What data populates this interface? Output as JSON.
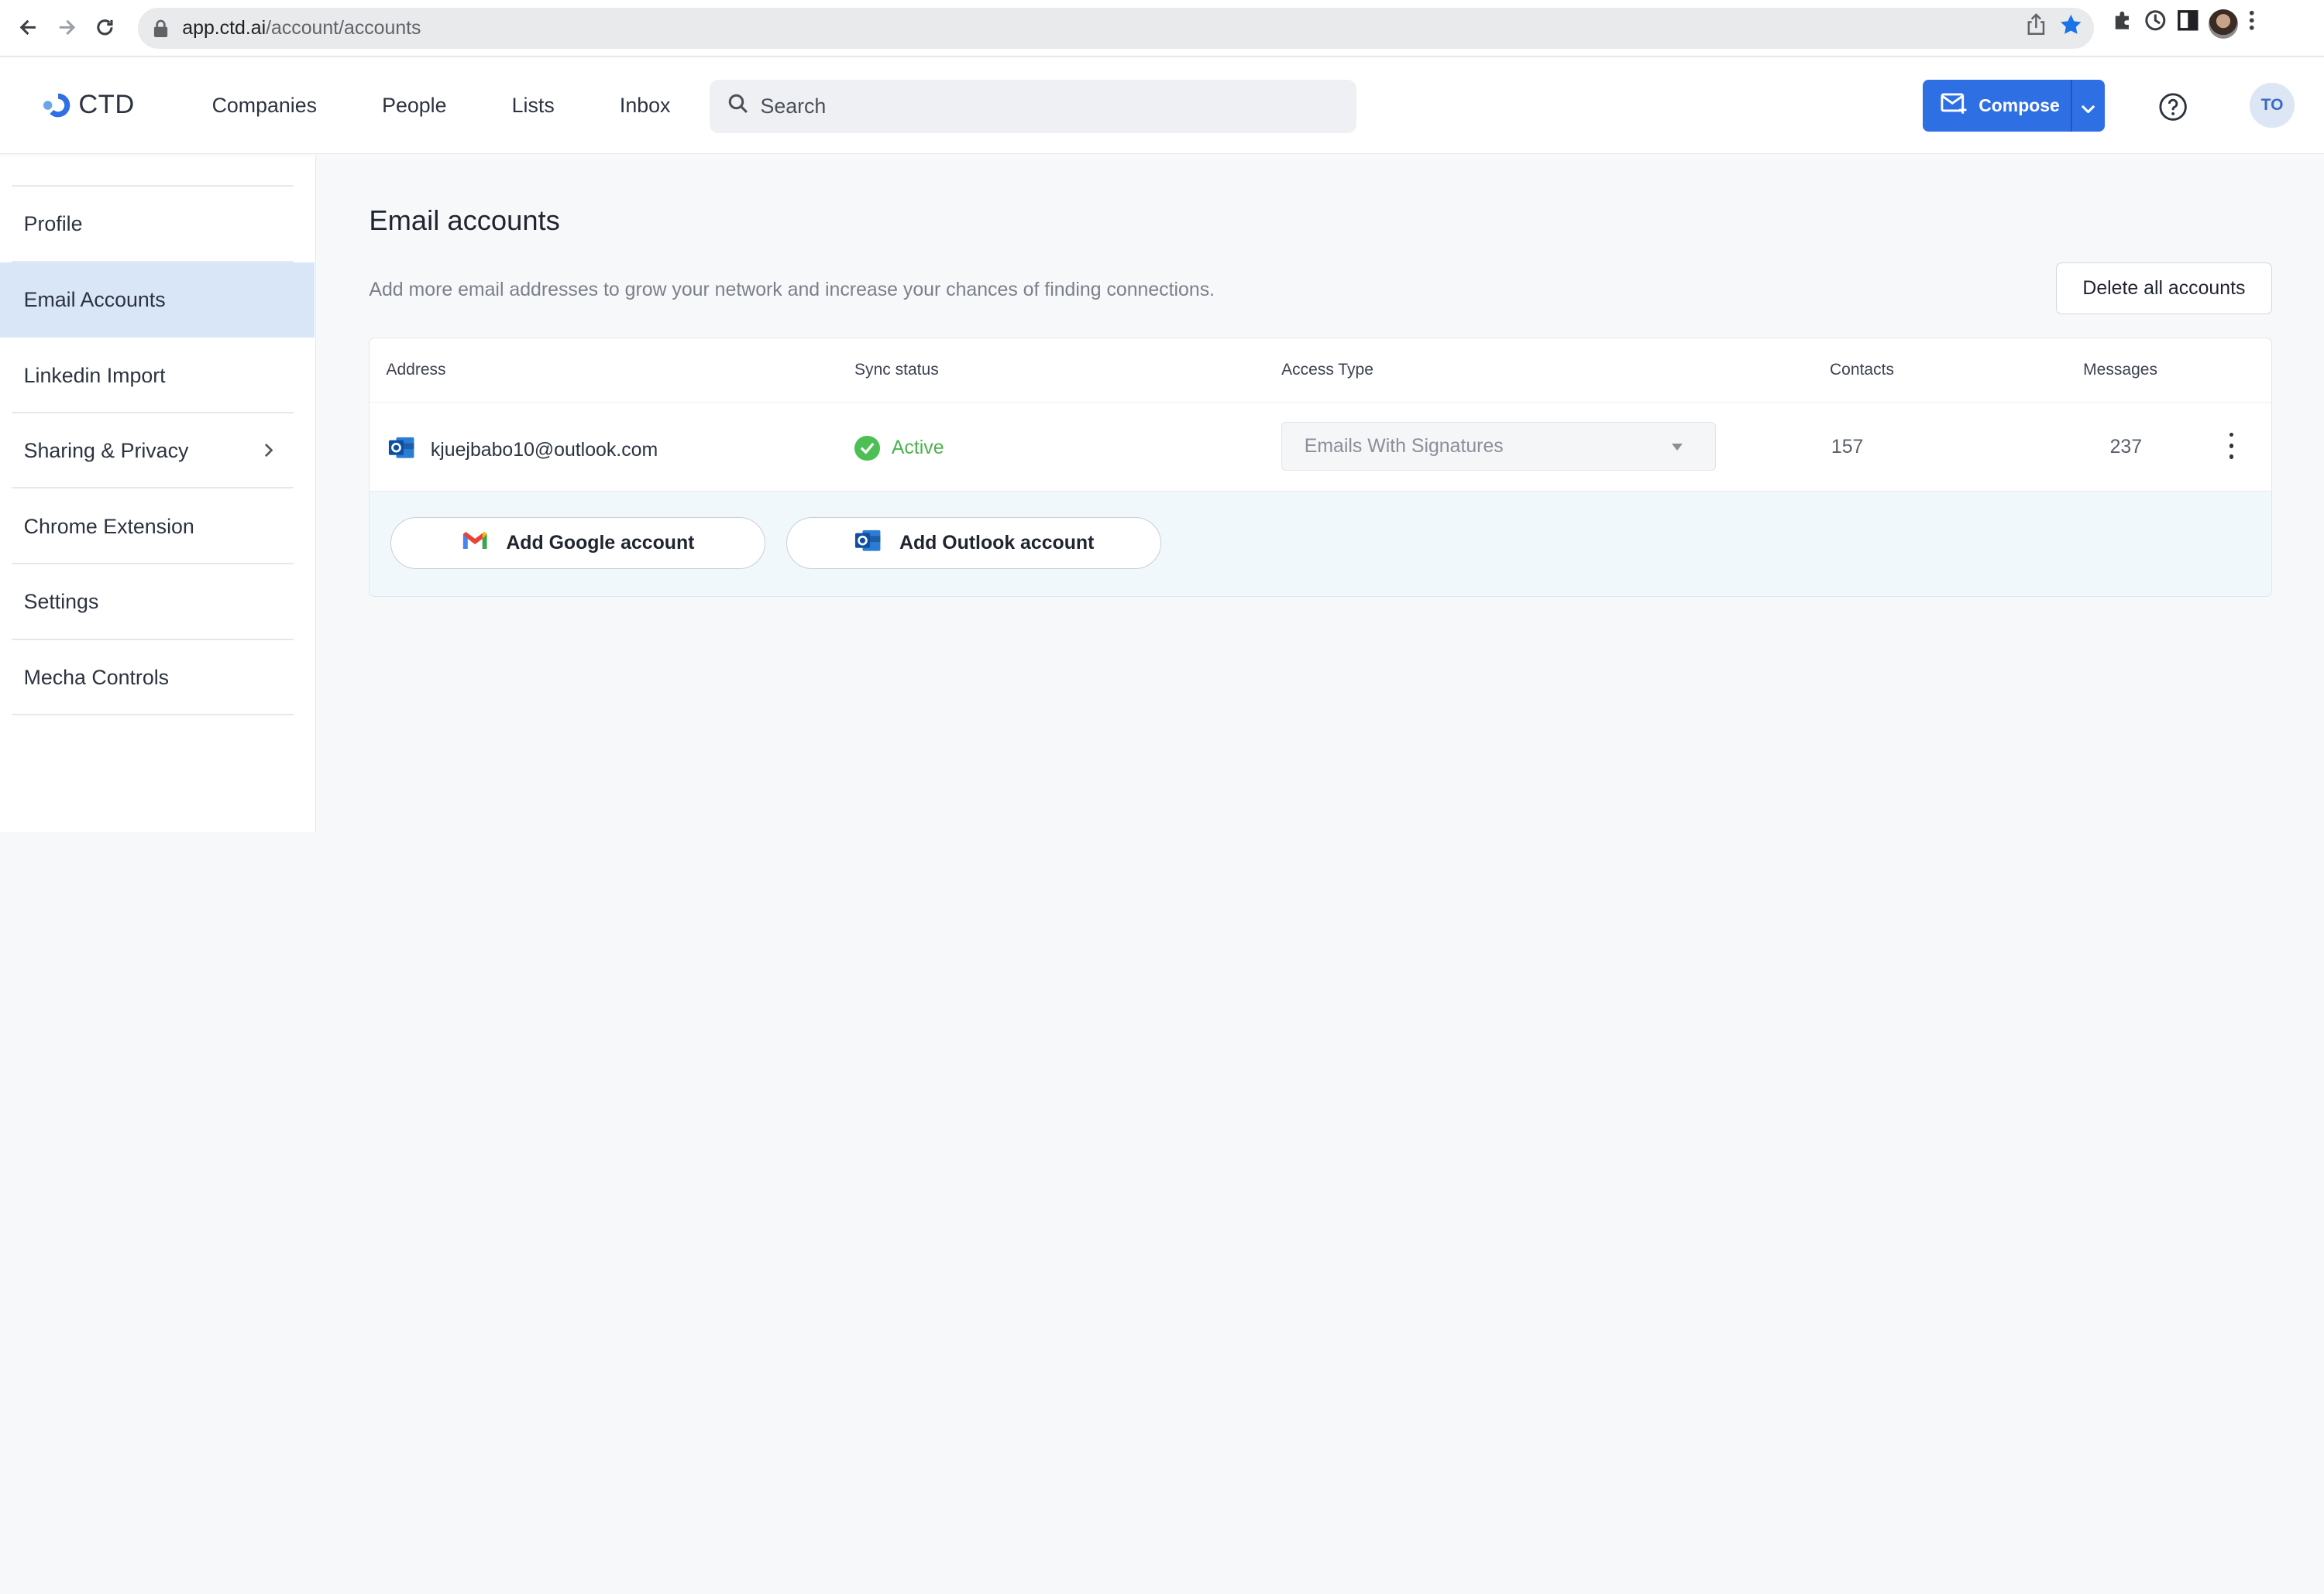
{
  "browser": {
    "url_host": "app.ctd.ai",
    "url_path": "/account/accounts"
  },
  "app": {
    "logo_text": "CTD",
    "nav": [
      "Companies",
      "People",
      "Lists",
      "Inbox"
    ],
    "search_placeholder": "Search",
    "compose_label": "Compose",
    "user_initials": "TO",
    "brand_color": "#2f6fe4"
  },
  "sidebar": {
    "items": [
      {
        "label": "Profile",
        "active": false
      },
      {
        "label": "Email Accounts",
        "active": true
      },
      {
        "label": "Linkedin Import",
        "active": false
      },
      {
        "label": "Sharing & Privacy",
        "active": false,
        "has_chevron": true
      },
      {
        "label": "Chrome Extension",
        "active": false
      },
      {
        "label": "Settings",
        "active": false
      },
      {
        "label": "Mecha Controls",
        "active": false
      }
    ]
  },
  "main": {
    "title": "Email accounts",
    "subtitle": "Add more email addresses to grow your network and increase your chances of finding connections.",
    "delete_all_label": "Delete all accounts",
    "table": {
      "headers": [
        "Address",
        "Sync status",
        "Access Type",
        "Contacts",
        "Messages"
      ],
      "rows": [
        {
          "address": "kjuejbabo10@outlook.com",
          "sync_status": "Active",
          "access_type": "Emails With Signatures",
          "contacts": "157",
          "messages": "237"
        }
      ]
    },
    "add_google_label": "Add Google account",
    "add_outlook_label": "Add Outlook account",
    "status_color": "#4cbf55"
  }
}
